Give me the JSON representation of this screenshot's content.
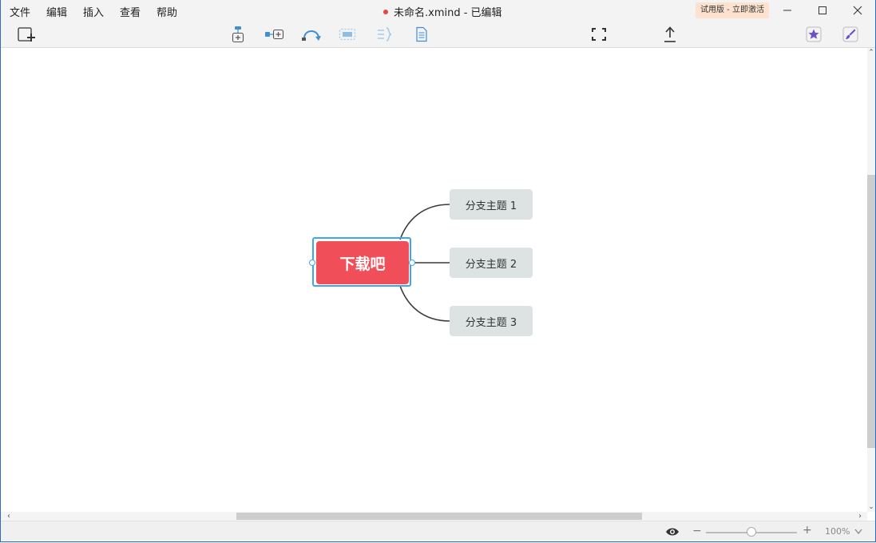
{
  "menubar": {
    "items": [
      "文件",
      "编辑",
      "插入",
      "查看",
      "帮助"
    ]
  },
  "title": {
    "text": "未命名.xmind - 已编辑",
    "unsaved_dot_color": "#e8453c"
  },
  "trial_badge": "试用版 - 立即激活",
  "window_controls": [
    "minimize-icon",
    "maximize-icon",
    "close-icon"
  ],
  "toolbar": {
    "icons": [
      "new-sheet-icon",
      "add-subtopic-icon",
      "add-topic-icon",
      "relationship-icon",
      "boundary-icon",
      "summary-icon",
      "notes-icon",
      "fullscreen-icon",
      "share-icon",
      "marker-icon",
      "format-icon"
    ]
  },
  "mindmap": {
    "central_topic": "下载吧",
    "central_color": "#f04f59",
    "branches": [
      "分支主题 1",
      "分支主题 2",
      "分支主题 3"
    ],
    "branch_color": "#dde2e3",
    "selection_color": "#3ea6f0"
  },
  "statusbar": {
    "zoom_value": "100%"
  }
}
